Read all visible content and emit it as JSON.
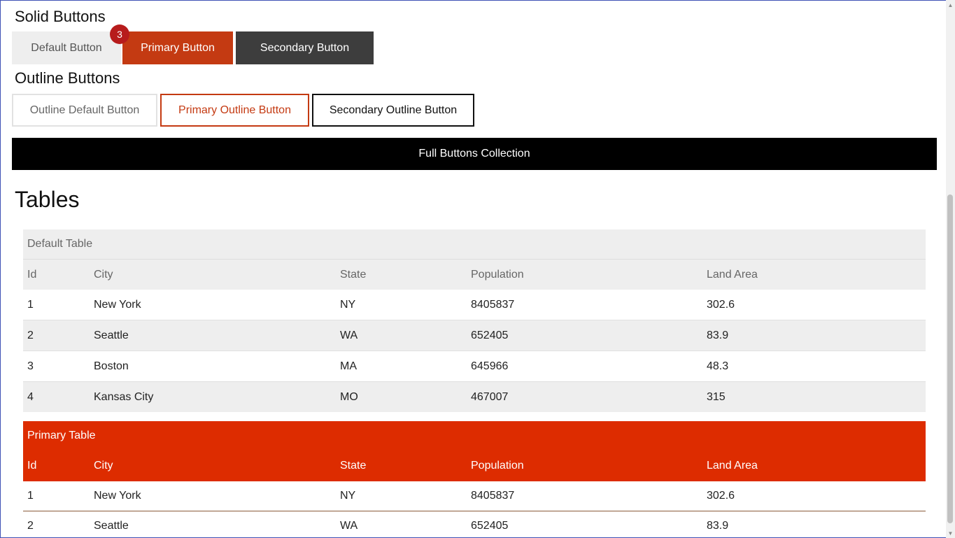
{
  "solid_section": {
    "title": "Solid Buttons",
    "default_label": "Default Button",
    "primary_label": "Primary Button",
    "secondary_label": "Secondary Button",
    "badge_count": "3"
  },
  "outline_section": {
    "title": "Outline Buttons",
    "default_label": "Outline Default Button",
    "primary_label": "Primary Outline Button",
    "secondary_label": "Secondary Outline Button"
  },
  "full_button": {
    "label": "Full Buttons Collection"
  },
  "tables_section": {
    "title": "Tables"
  },
  "default_table": {
    "caption": "Default Table",
    "columns": [
      "Id",
      "City",
      "State",
      "Population",
      "Land Area"
    ],
    "rows": [
      [
        "1",
        "New York",
        "NY",
        "8405837",
        "302.6"
      ],
      [
        "2",
        "Seattle",
        "WA",
        "652405",
        "83.9"
      ],
      [
        "3",
        "Boston",
        "MA",
        "645966",
        "48.3"
      ],
      [
        "4",
        "Kansas City",
        "MO",
        "467007",
        "315"
      ]
    ]
  },
  "primary_table": {
    "caption": "Primary Table",
    "columns": [
      "Id",
      "City",
      "State",
      "Population",
      "Land Area"
    ],
    "rows": [
      [
        "1",
        "New York",
        "NY",
        "8405837",
        "302.6"
      ],
      [
        "2",
        "Seattle",
        "WA",
        "652405",
        "83.9"
      ]
    ]
  },
  "colors": {
    "primary": "#c43a12",
    "primary_table": "#dd2c00",
    "secondary": "#3d3d3d",
    "badge": "#b71c1c",
    "frame_border": "#3f51b5"
  },
  "icons": {
    "scroll_up": "▲",
    "scroll_down": "▼"
  }
}
